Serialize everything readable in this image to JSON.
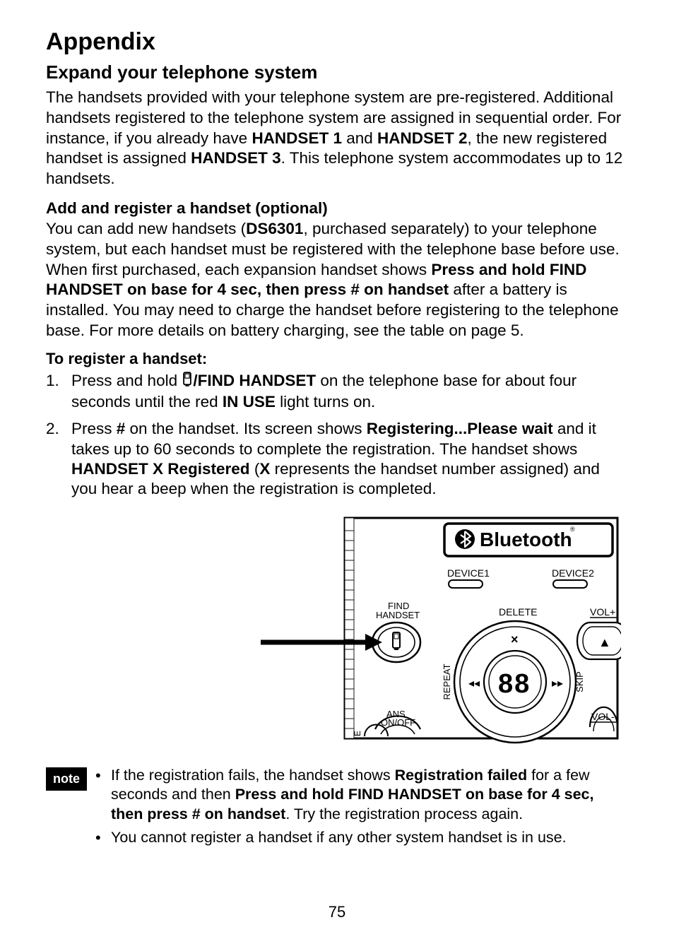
{
  "page": {
    "title": "Appendix",
    "section1": {
      "heading": "Expand your telephone system",
      "para_a": "The handsets provided with your telephone system are pre-registered. Additional handsets registered to the telephone system are assigned in sequential order. For instance, if you already have ",
      "hs1": "HANDSET 1",
      "and": " and ",
      "hs2": "HANDSET 2",
      "para_b": ", the new registered handset is assigned ",
      "hs3": "HANDSET 3",
      "para_c": ". This telephone system accommodates up to 12 handsets."
    },
    "section2": {
      "heading": "Add and register a handset (optional)",
      "p1a": "You can add new handsets (",
      "model": "DS6301",
      "p1b": ", purchased separately) to your telephone system, but each handset must be registered with the telephone base before use. When first purchased, each expansion handset shows ",
      "prompt": "Press and hold FIND HANDSET on base for 4 sec, then press # on handset",
      "p1c": " after a battery is installed. You may need to charge the handset before registering to the telephone base. For more details on battery charging, see the table on page 5.",
      "register_heading": "To register a handset:",
      "steps": {
        "s1": {
          "num": "1.",
          "a": "Press and hold ",
          "btn": "/FIND HANDSET",
          "b": " on the telephone base for about four seconds until the red ",
          "inuse": "IN USE",
          "c": " light turns on."
        },
        "s2": {
          "num": "2.",
          "a": "Press ",
          "hash": "#",
          "b": " on the handset. Its screen shows ",
          "reg": "Registering...Please wait",
          "c": " and it takes up to 60 seconds to complete the registration. The handset shows ",
          "hx": "HANDSET X Registered",
          "d": " (",
          "x": "X",
          "e": " represents the handset number assigned) and you hear a beep when the registration is completed."
        }
      }
    },
    "figure": {
      "bluetooth": "Bluetooth",
      "device1": "DEVICE1",
      "device2": "DEVICE2",
      "find_handset": "FIND\nHANDSET",
      "delete": "DELETE",
      "volp": "VOL+",
      "volm": "VOL-",
      "repeat": "REPEAT",
      "skip": "SKIP",
      "display": "88",
      "ans": "ANS\nON/OFF"
    },
    "notes": {
      "label": "note",
      "n1a": "If the registration fails, the handset shows ",
      "n1b": "Registration failed",
      "n1c": " for a few seconds and then ",
      "n1d": "Press and hold FIND HANDSET on base for 4 sec, then press # on handset",
      "n1e": ". Try the registration process again.",
      "n2": "You cannot register a handset if any other system handset is in use."
    },
    "page_number": "75"
  }
}
